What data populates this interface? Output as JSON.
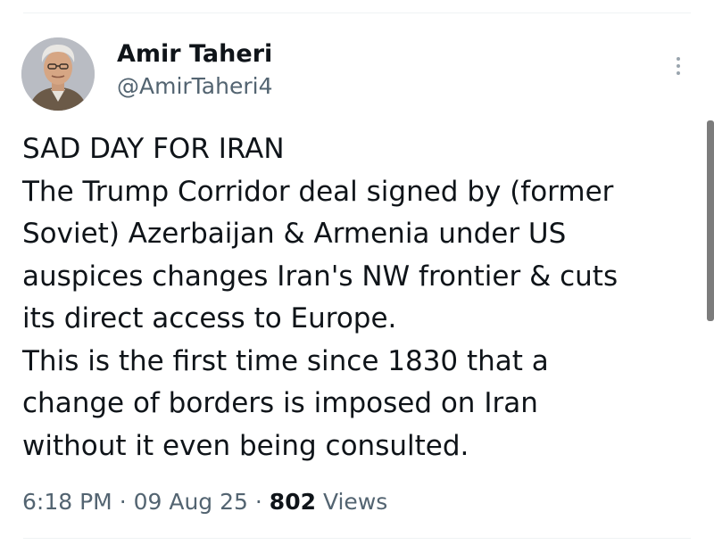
{
  "author": {
    "name": "Amir Taheri",
    "handle": "@AmirTaheri4"
  },
  "more_icon": "vertical-ellipsis-icon",
  "tweet": {
    "lines": [
      "SAD DAY FOR IRAN",
      "The Trump Corridor deal signed by (former",
      "Soviet) Azerbaijan & Armenia under US",
      "auspices changes Iran's NW frontier & cuts",
      "its direct access to Europe.",
      "This is the first time since 1830 that a",
      "change of borders is imposed on Iran",
      "without it even being consulted."
    ]
  },
  "meta": {
    "time": "6:18 PM",
    "date": "09 Aug 25",
    "separator": "·",
    "views_count": "802",
    "views_label": "Views"
  },
  "colors": {
    "text": "#0f1419",
    "secondary": "#536471",
    "divider": "#eff3f4"
  }
}
